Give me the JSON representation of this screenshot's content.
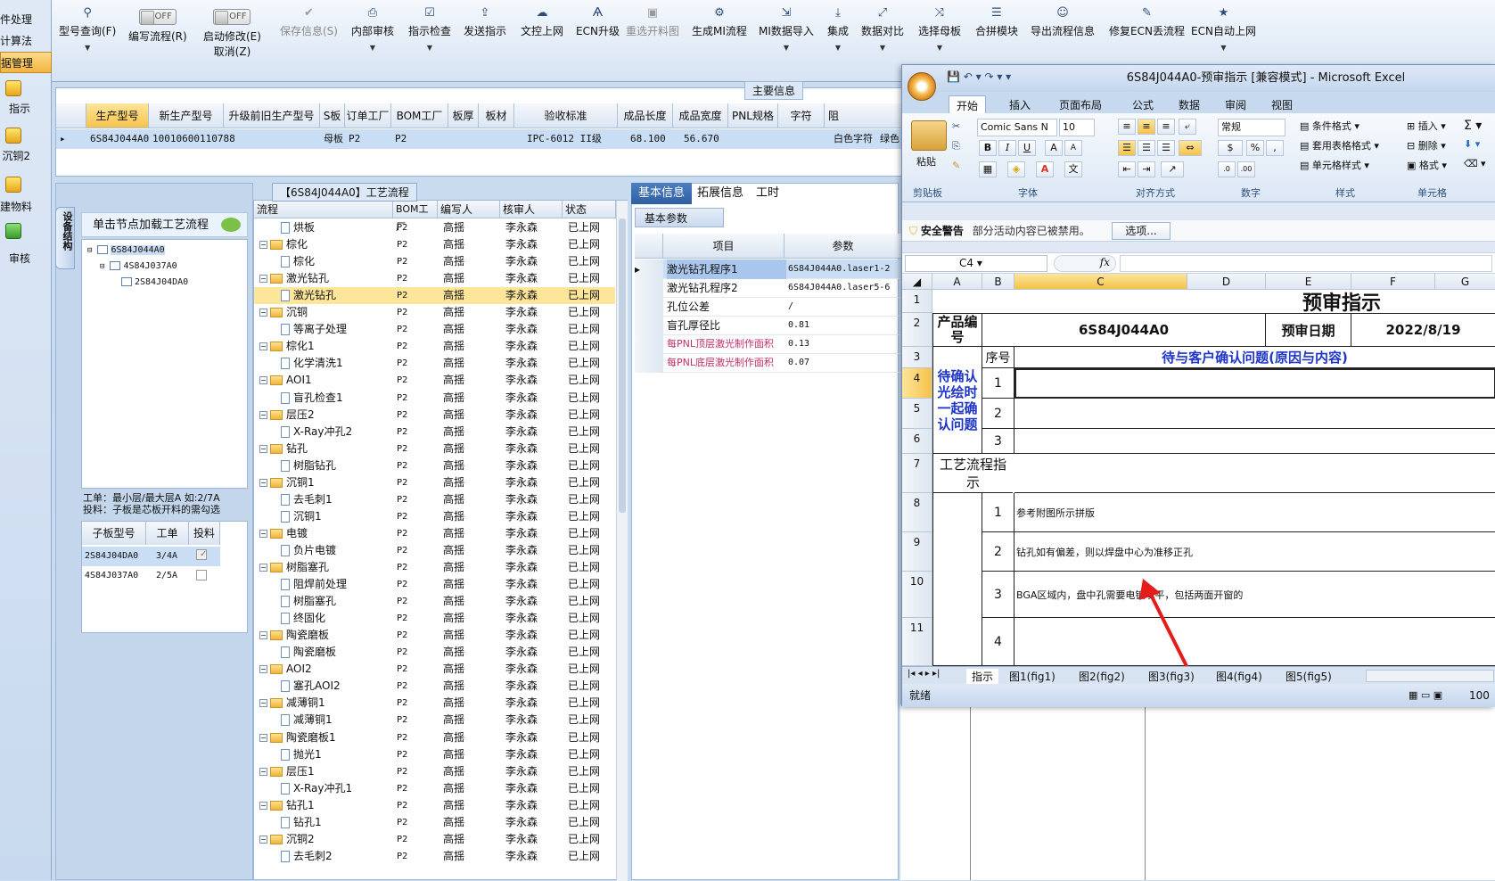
{
  "leftstrip": {
    "items": [
      {
        "label": "件处理",
        "active": false
      },
      {
        "label": "计算法",
        "active": false
      },
      {
        "label": "据管理",
        "active": true
      },
      {
        "label": "指示",
        "active": false
      },
      {
        "label": "沉铜2",
        "active": false
      },
      {
        "label": "建物料",
        "active": false
      },
      {
        "label": "审核",
        "active": false
      }
    ]
  },
  "toolbar": {
    "type_query": "型号查询(F)",
    "write_flow": "编写流程(R)",
    "off1": "OFF",
    "start_modify": "启动修改(E)",
    "off2": "OFF",
    "cancel": "取消(Z)",
    "save_info": "保存信息(S)",
    "internal_review": "内部审核",
    "guide_check": "指示检查",
    "send_guide": "发送指示",
    "doc_upload": "文控上网",
    "ecn_upgrade": "ECN升级",
    "reselect_cut": "重选开料图",
    "gen_mi": "生成MI流程",
    "mi_import": "MI数据导入",
    "integrate": "集成",
    "data_compare": "数据对比",
    "select_master": "选择母板",
    "merge_module": "合拼模块",
    "export_flow": "导出流程信息",
    "fix_ecn": "修复ECN丢流程",
    "ecn_auto": "ECN自动上网"
  },
  "main_info": {
    "title": "主要信息",
    "headers": [
      "生产型号",
      "新生产型号",
      "升级前旧生产型号",
      "S板",
      "订单工厂",
      "BOM工厂",
      "板厚",
      "板材",
      "验收标准",
      "成品长度",
      "成品宽度",
      "PNL规格",
      "字符",
      "阻"
    ],
    "row": [
      "6S84J044A0",
      "10010600110788",
      "",
      "母板",
      "P2",
      "P2",
      "",
      "",
      "IPC-6012 II级",
      "68.100",
      "56.670",
      "",
      "白色字符",
      "绿色"
    ]
  },
  "left_panel": {
    "side_tab": "设备结构",
    "load_tip": "单击节点加载工艺流程",
    "tree": [
      "6S84J044A0",
      "4S84J037A0",
      "2S84J04DA0"
    ],
    "info_line1": "工单：最小层/最大层A 如:2/7A",
    "info_line2": "投料：子板是芯板开料的需勾选",
    "subgrid": {
      "headers": [
        "子板型号",
        "工单",
        "投料"
      ],
      "rows": [
        {
          "model": "2S84J04DA0",
          "order": "3/4A"
        },
        {
          "model": "4S84J037A0",
          "order": "2/5A"
        }
      ]
    }
  },
  "process": {
    "title": "【6S84J044A0】工艺流程",
    "headers": [
      "流程",
      "BOM工厂",
      "编写人",
      "核审人",
      "状态"
    ],
    "rows": [
      {
        "name": "烘板",
        "folder": false,
        "factory": "P2",
        "writer": "高揺",
        "reviewer": "李永森",
        "status": "已上网"
      },
      {
        "name": "棕化",
        "folder": true,
        "factory": "P2",
        "writer": "高揺",
        "reviewer": "李永森",
        "status": "已上网"
      },
      {
        "name": "棕化",
        "folder": false,
        "factory": "P2",
        "writer": "高揺",
        "reviewer": "李永森",
        "status": "已上网"
      },
      {
        "name": "激光钻孔",
        "folder": true,
        "factory": "P2",
        "writer": "高揺",
        "reviewer": "李永森",
        "status": "已上网"
      },
      {
        "name": "激光钻孔",
        "folder": false,
        "factory": "P2",
        "writer": "高揺",
        "reviewer": "李永森",
        "status": "已上网",
        "selected": true
      },
      {
        "name": "沉铜",
        "folder": true,
        "factory": "P2",
        "writer": "高揺",
        "reviewer": "李永森",
        "status": "已上网"
      },
      {
        "name": "等离子处理",
        "folder": false,
        "factory": "P2",
        "writer": "高揺",
        "reviewer": "李永森",
        "status": "已上网"
      },
      {
        "name": "棕化1",
        "folder": true,
        "factory": "P2",
        "writer": "高揺",
        "reviewer": "李永森",
        "status": "已上网"
      },
      {
        "name": "化学清洗1",
        "folder": false,
        "factory": "P2",
        "writer": "高揺",
        "reviewer": "李永森",
        "status": "已上网"
      },
      {
        "name": "AOI1",
        "folder": true,
        "factory": "P2",
        "writer": "高揺",
        "reviewer": "李永森",
        "status": "已上网"
      },
      {
        "name": "盲孔检查1",
        "folder": false,
        "factory": "P2",
        "writer": "高揺",
        "reviewer": "李永森",
        "status": "已上网"
      },
      {
        "name": "层压2",
        "folder": true,
        "factory": "P2",
        "writer": "高揺",
        "reviewer": "李永森",
        "status": "已上网"
      },
      {
        "name": "X-Ray冲孔2",
        "folder": false,
        "factory": "P2",
        "writer": "高揺",
        "reviewer": "李永森",
        "status": "已上网"
      },
      {
        "name": "钻孔",
        "folder": true,
        "factory": "P2",
        "writer": "高揺",
        "reviewer": "李永森",
        "status": "已上网"
      },
      {
        "name": "树脂钻孔",
        "folder": false,
        "factory": "P2",
        "writer": "高揺",
        "reviewer": "李永森",
        "status": "已上网"
      },
      {
        "name": "沉铜1",
        "folder": true,
        "factory": "P2",
        "writer": "高揺",
        "reviewer": "李永森",
        "status": "已上网"
      },
      {
        "name": "去毛刺1",
        "folder": false,
        "factory": "P2",
        "writer": "高揺",
        "reviewer": "李永森",
        "status": "已上网"
      },
      {
        "name": "沉铜1",
        "folder": false,
        "factory": "P2",
        "writer": "高揺",
        "reviewer": "李永森",
        "status": "已上网"
      },
      {
        "name": "电镀",
        "folder": true,
        "factory": "P2",
        "writer": "高揺",
        "reviewer": "李永森",
        "status": "已上网"
      },
      {
        "name": "负片电镀",
        "folder": false,
        "factory": "P2",
        "writer": "高揺",
        "reviewer": "李永森",
        "status": "已上网"
      },
      {
        "name": "树脂塞孔",
        "folder": true,
        "factory": "P2",
        "writer": "高揺",
        "reviewer": "李永森",
        "status": "已上网"
      },
      {
        "name": "阻焊前处理",
        "folder": false,
        "factory": "P2",
        "writer": "高揺",
        "reviewer": "李永森",
        "status": "已上网"
      },
      {
        "name": "树脂塞孔",
        "folder": false,
        "factory": "P2",
        "writer": "高揺",
        "reviewer": "李永森",
        "status": "已上网"
      },
      {
        "name": "终固化",
        "folder": false,
        "factory": "P2",
        "writer": "高揺",
        "reviewer": "李永森",
        "status": "已上网"
      },
      {
        "name": "陶瓷磨板",
        "folder": true,
        "factory": "P2",
        "writer": "高揺",
        "reviewer": "李永森",
        "status": "已上网"
      },
      {
        "name": "陶瓷磨板",
        "folder": false,
        "factory": "P2",
        "writer": "高揺",
        "reviewer": "李永森",
        "status": "已上网"
      },
      {
        "name": "AOI2",
        "folder": true,
        "factory": "P2",
        "writer": "高揺",
        "reviewer": "李永森",
        "status": "已上网"
      },
      {
        "name": "塞孔AOI2",
        "folder": false,
        "factory": "P2",
        "writer": "高揺",
        "reviewer": "李永森",
        "status": "已上网"
      },
      {
        "name": "减薄铜1",
        "folder": true,
        "factory": "P2",
        "writer": "高揺",
        "reviewer": "李永森",
        "status": "已上网"
      },
      {
        "name": "减薄铜1",
        "folder": false,
        "factory": "P2",
        "writer": "高揺",
        "reviewer": "李永森",
        "status": "已上网"
      },
      {
        "name": "陶瓷磨板1",
        "folder": true,
        "factory": "P2",
        "writer": "高揺",
        "reviewer": "李永森",
        "status": "已上网"
      },
      {
        "name": "抛光1",
        "folder": false,
        "factory": "P2",
        "writer": "高揺",
        "reviewer": "李永森",
        "status": "已上网"
      },
      {
        "name": "层压1",
        "folder": true,
        "factory": "P2",
        "writer": "高揺",
        "reviewer": "李永森",
        "status": "已上网"
      },
      {
        "name": "X-Ray冲孔1",
        "folder": false,
        "factory": "P2",
        "writer": "高揺",
        "reviewer": "李永森",
        "status": "已上网"
      },
      {
        "name": "钻孔1",
        "folder": true,
        "factory": "P2",
        "writer": "高揺",
        "reviewer": "李永森",
        "status": "已上网"
      },
      {
        "name": "钻孔1",
        "folder": false,
        "factory": "P2",
        "writer": "高揺",
        "reviewer": "李永森",
        "status": "已上网"
      },
      {
        "name": "沉铜2",
        "folder": true,
        "factory": "P2",
        "writer": "高揺",
        "reviewer": "李永森",
        "status": "已上网"
      },
      {
        "name": "去毛刺2",
        "folder": false,
        "factory": "P2",
        "writer": "高揺",
        "reviewer": "李永森",
        "status": "已上网"
      }
    ]
  },
  "right_pane": {
    "tabs": [
      "基本信息",
      "拓展信息",
      "工时"
    ],
    "sub_tab": "基本参数",
    "headers": [
      "项目",
      "参数"
    ],
    "rows": [
      {
        "key": "激光钻孔程序1",
        "value": "6S84J044A0.laser1-2",
        "pink": false
      },
      {
        "key": "激光钻孔程序2",
        "value": "6S84J044A0.laser5-6",
        "pink": false
      },
      {
        "key": "孔位公差",
        "value": "/",
        "pink": false
      },
      {
        "key": "盲孔厚径比",
        "value": "0.81",
        "pink": false
      },
      {
        "key": "每PNL顶层激光制作面积",
        "value": "0.13",
        "pink": true
      },
      {
        "key": "每PNL底层激光制作面积",
        "value": "0.07",
        "pink": true
      }
    ]
  },
  "excel": {
    "title": "6S84J044A0-预审指示 [兼容模式] - Microsoft Excel",
    "tabs": [
      "开始",
      "插入",
      "页面布局",
      "公式",
      "数据",
      "审阅",
      "视图"
    ],
    "font_name": "Comic Sans N",
    "font_size": "10",
    "number_format": "常规",
    "paste": "粘贴",
    "groups": [
      "剪贴板",
      "字体",
      "对齐方式",
      "数字",
      "样式",
      "单元格"
    ],
    "styles": [
      "条件格式",
      "套用表格格式",
      "单元格样式"
    ],
    "cells_btns": [
      "插入",
      "删除",
      "格式"
    ],
    "warning_title": "安全警告",
    "warning_text": "部分活动内容已被禁用。",
    "options_btn": "选项...",
    "cell_ref": "C4",
    "fx": "fx",
    "columns": [
      "A",
      "B",
      "C",
      "D",
      "E",
      "F",
      "G"
    ],
    "rows": [
      "1",
      "2",
      "3",
      "4",
      "5",
      "6",
      "7",
      "8",
      "9",
      "10",
      "11"
    ],
    "sheet_title": "预审指示",
    "product_label": "产品编号",
    "product_no": "6S84J044A0",
    "review_date_label": "预审日期",
    "review_date": "2022/8/19",
    "seq_label": "序号",
    "confirm_header": "待与客户确认问题(原因与内容)",
    "pending_label": "待确认光绘时一起确认问题",
    "process_label": "工艺流程指示",
    "items": [
      {
        "no": "1",
        "text": ""
      },
      {
        "no": "2",
        "text": ""
      },
      {
        "no": "3",
        "text": ""
      }
    ],
    "instructions": [
      {
        "no": "1",
        "text": "参考附图所示拼版"
      },
      {
        "no": "2",
        "text": "钻孔如有偏差，则以焊盘中心为准移正孔"
      },
      {
        "no": "3",
        "text": "BGA区域内，盘中孔需要电镀填平，包括两面开窗的"
      },
      {
        "no": "4",
        "text": ""
      }
    ],
    "sheet_tabs": [
      "指示",
      "图1(fig1)",
      "图2(fig2)",
      "图3(fig3)",
      "图4(fig4)",
      "图5(fig5)"
    ],
    "status": "就绪",
    "zoom": "100"
  }
}
